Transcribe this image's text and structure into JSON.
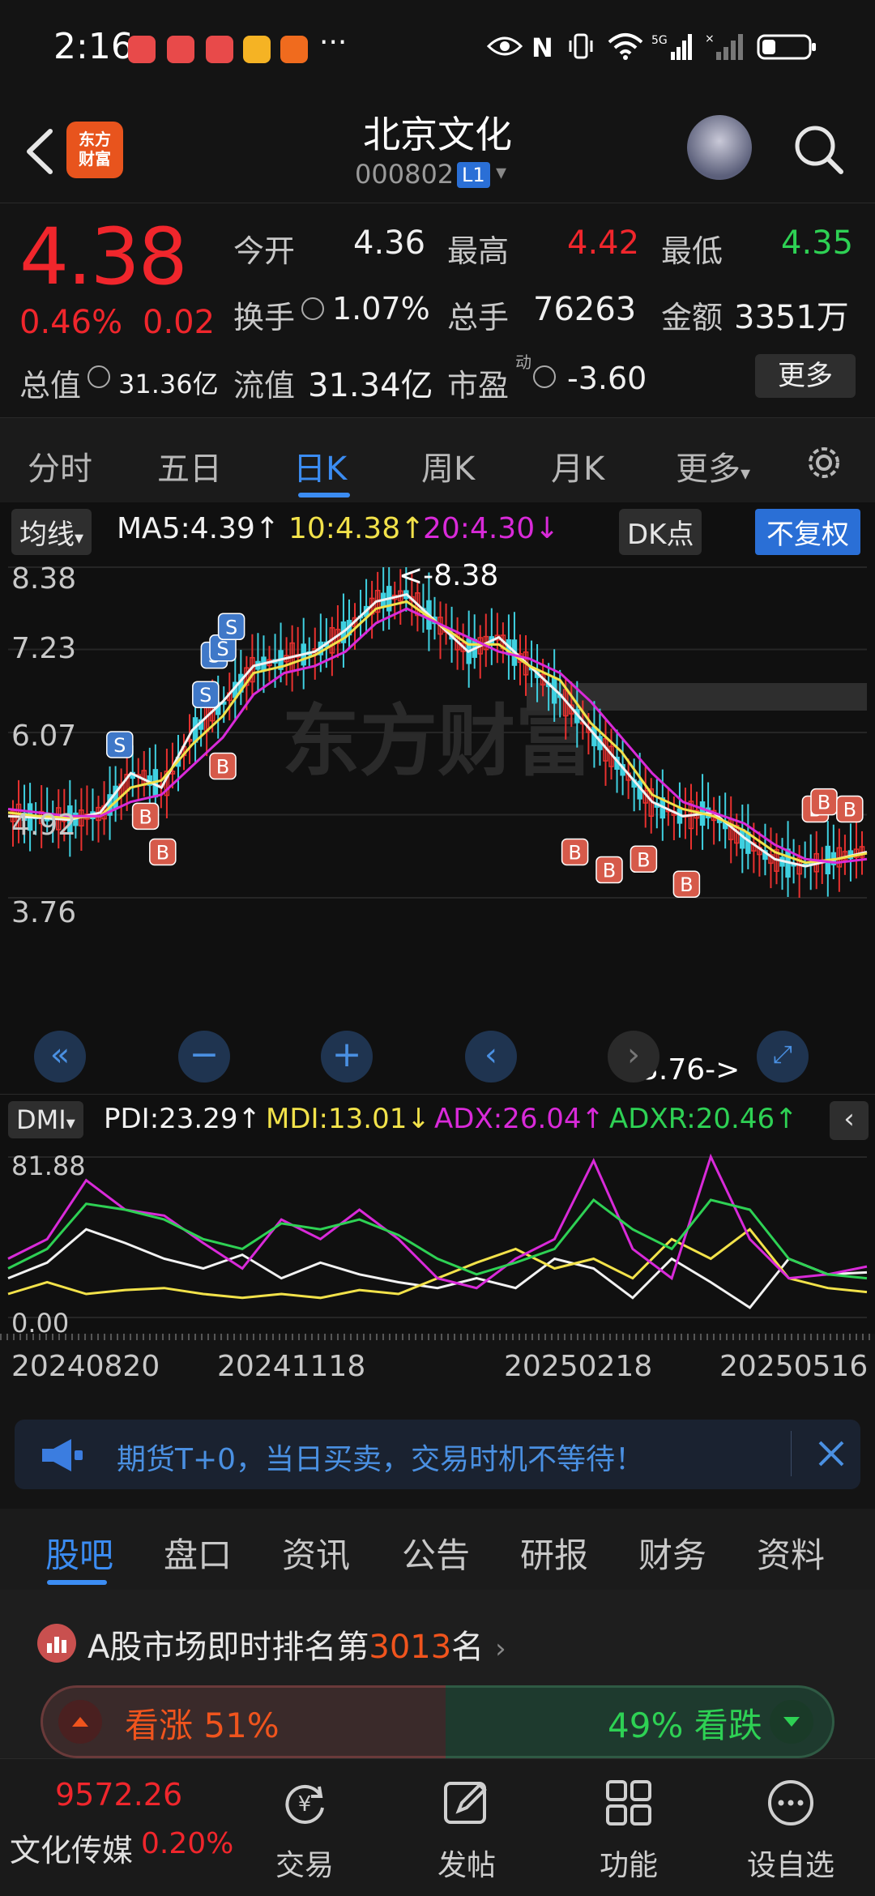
{
  "status_bar": {
    "time": "2:16",
    "more": "···",
    "network": "5G"
  },
  "header": {
    "stock_name": "北京文化",
    "stock_code": "000802",
    "badge": "L1",
    "logo_text_line1": "东方",
    "logo_text_line2": "财富"
  },
  "quote": {
    "price": "4.38",
    "change_pct": "0.46%",
    "change_abs": "0.02",
    "open_label": "今开",
    "open": "4.36",
    "high_label": "最高",
    "high": "4.42",
    "low_label": "最低",
    "low": "4.35",
    "turnover_label": "换手",
    "turnover": "1.07%",
    "volume_label": "总手",
    "volume": "76263",
    "amount_label": "金额",
    "amount": "3351万",
    "mktcap_label": "总值",
    "mktcap": "31.36亿",
    "float_label": "流值",
    "float_cap": "31.34亿",
    "pe_label": "市盈",
    "pe_sup": "动",
    "pe": "-3.60",
    "more": "更多",
    "colors": {
      "up": "#f0262c",
      "down": "#2ed154"
    }
  },
  "kline_tabs": [
    "分时",
    "五日",
    "日K",
    "周K",
    "月K",
    "更多"
  ],
  "kline_active": "日K",
  "ma_bar": {
    "selector": "均线",
    "ma5": "MA5:4.39↑",
    "ma10": "10:4.38↑",
    "ma20": "20:4.30↓",
    "dk": "DK点",
    "adjust": "不复权"
  },
  "chart_data": [
    {
      "type": "line",
      "title": "",
      "y_ticks": [
        "8.38",
        "7.23",
        "6.07",
        "4.92",
        "3.76"
      ],
      "ylim": [
        3.76,
        8.38
      ],
      "high_marker": "<-8.38",
      "low_marker": "3.76->",
      "x_ticks": [
        "20240820",
        "20241118",
        "20250218",
        "20250516"
      ],
      "series": [
        {
          "name": "MA5",
          "color": "#f2f2f2",
          "values": [
            4.9,
            4.88,
            4.85,
            4.95,
            5.5,
            5.3,
            6.1,
            6.5,
            7.0,
            7.1,
            7.2,
            7.5,
            7.9,
            8.0,
            7.6,
            7.2,
            7.4,
            7.0,
            6.6,
            6.1,
            5.6,
            5.1,
            4.9,
            4.95,
            4.6,
            4.3,
            4.2,
            4.3,
            4.4
          ]
        },
        {
          "name": "10",
          "color": "#f2e24a",
          "values": [
            4.95,
            4.9,
            4.88,
            4.9,
            5.3,
            5.4,
            5.9,
            6.3,
            6.9,
            7.0,
            7.15,
            7.4,
            7.8,
            7.9,
            7.6,
            7.3,
            7.3,
            7.0,
            6.8,
            6.2,
            5.8,
            5.2,
            5.0,
            4.9,
            4.7,
            4.4,
            4.25,
            4.3,
            4.38
          ]
        },
        {
          "name": "20",
          "color": "#d92ad9",
          "values": [
            5.0,
            4.95,
            4.9,
            4.9,
            5.1,
            5.2,
            5.6,
            6.0,
            6.6,
            6.9,
            7.0,
            7.2,
            7.6,
            7.8,
            7.6,
            7.4,
            7.2,
            7.1,
            6.9,
            6.5,
            6.0,
            5.5,
            5.1,
            4.95,
            4.8,
            4.5,
            4.3,
            4.25,
            4.3
          ]
        }
      ]
    },
    {
      "type": "line",
      "title": "DMI",
      "y_ticks": [
        "81.88",
        "0.00"
      ],
      "ylim": [
        0,
        81.88
      ],
      "series": [
        {
          "name": "PDI",
          "color": "#f2f2f2",
          "values": [
            20,
            28,
            45,
            38,
            30,
            25,
            32,
            20,
            28,
            22,
            18,
            15,
            20,
            15,
            30,
            25,
            10,
            30,
            18,
            5,
            30,
            22,
            23
          ]
        },
        {
          "name": "MDI",
          "color": "#f2e24a",
          "values": [
            12,
            18,
            12,
            14,
            15,
            12,
            10,
            12,
            10,
            14,
            12,
            20,
            28,
            35,
            25,
            30,
            20,
            40,
            30,
            45,
            20,
            15,
            13
          ]
        },
        {
          "name": "ADX",
          "color": "#d92ad9",
          "values": [
            30,
            40,
            70,
            55,
            52,
            38,
            25,
            50,
            40,
            55,
            40,
            20,
            15,
            30,
            40,
            80,
            35,
            20,
            82,
            40,
            20,
            22,
            26
          ]
        },
        {
          "name": "ADXR",
          "color": "#2ed154",
          "values": [
            25,
            35,
            58,
            55,
            50,
            40,
            35,
            48,
            45,
            50,
            42,
            30,
            22,
            28,
            35,
            60,
            45,
            35,
            60,
            55,
            30,
            22,
            20
          ]
        }
      ]
    }
  ],
  "dmi_bar": {
    "selector": "DMI",
    "pdi": "PDI:23.29↑",
    "mdi": "MDI:13.01↓",
    "adx": "ADX:26.04↑",
    "adxr": "ADXR:20.46↑"
  },
  "watermark": "东方财富",
  "ad": {
    "text": "期货T+0，当日买卖，交易时机不等待！"
  },
  "bottom_tabs": [
    "股吧",
    "盘口",
    "资讯",
    "公告",
    "研报",
    "财务",
    "资料"
  ],
  "bottom_tab_active": "股吧",
  "rank": {
    "prefix": "A股市场即时排名第",
    "number": "3013",
    "suffix": "名",
    "bull_label": "看涨 51%",
    "bear_label": "49% 看跌",
    "bull_pct": 51,
    "bear_pct": 49
  },
  "nav": {
    "index_value": "9572.26",
    "index_name": "文化传媒",
    "index_change": "0.20%",
    "items": [
      "交易",
      "发帖",
      "功能",
      "设自选"
    ]
  }
}
